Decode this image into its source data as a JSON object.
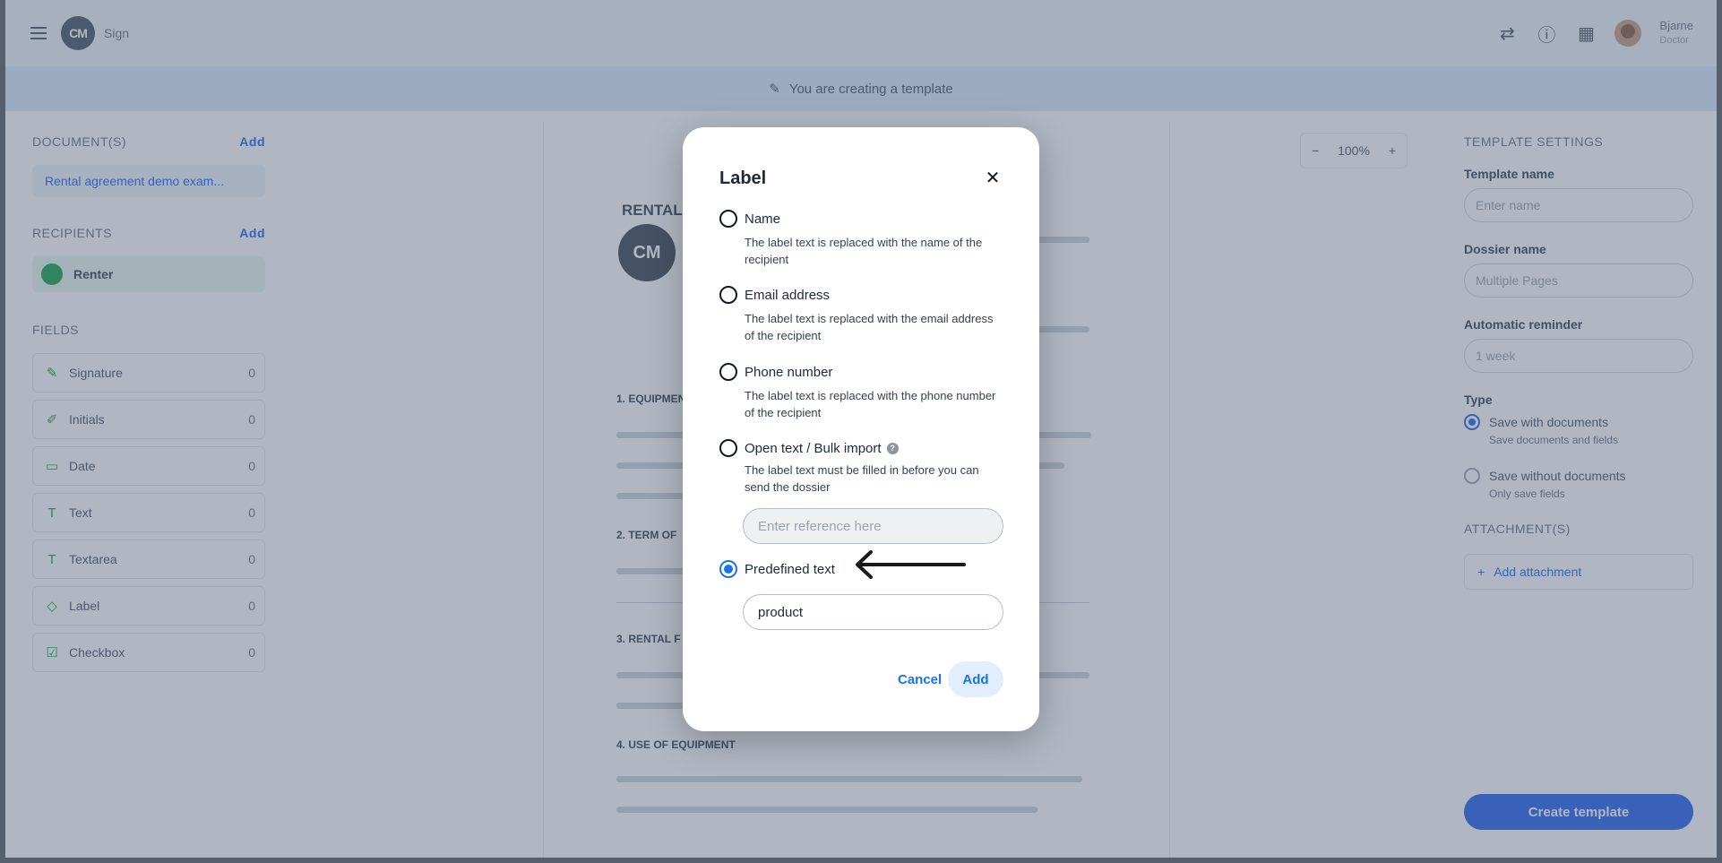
{
  "topbar": {
    "logo_text": "CM",
    "app_name": "Sign",
    "user_name": "Bjarne",
    "user_sub": "Doctor"
  },
  "banner": {
    "text": "You are creating a template"
  },
  "left": {
    "documents_heading": "DOCUMENT(S)",
    "add_label": "Add",
    "document_name": "Rental agreement demo exam...",
    "recipients_heading": "RECIPIENTS",
    "recipient_name": "Renter",
    "fields_heading": "FIELDS",
    "fields": [
      {
        "label": "Signature",
        "count": "0"
      },
      {
        "label": "Initials",
        "count": "0"
      },
      {
        "label": "Date",
        "count": "0"
      },
      {
        "label": "Text",
        "count": "0"
      },
      {
        "label": "Textarea",
        "count": "0"
      },
      {
        "label": "Label",
        "count": "0"
      },
      {
        "label": "Checkbox",
        "count": "0"
      }
    ]
  },
  "document": {
    "zoom": "100%",
    "title": "RENTAL",
    "logo_text": "CM",
    "h1": "1. EQUIPMENT",
    "h2": "2. TERM OF",
    "h3": "3. RENTAL F",
    "h4": "4. USE OF EQUIPMENT"
  },
  "right": {
    "heading": "TEMPLATE SETTINGS",
    "template_name_label": "Template name",
    "template_name_placeholder": "Enter name",
    "dossier_name_label": "Dossier name",
    "dossier_name_value": "Multiple Pages",
    "reminder_label": "Automatic reminder",
    "reminder_value": "1 week",
    "type_label": "Type",
    "type_option1": "Save with documents",
    "type_option1_sub": "Save documents and fields",
    "type_option2": "Save without documents",
    "type_option2_sub": "Only save fields",
    "attachments_heading": "ATTACHMENT(S)",
    "add_attachment": "Add attachment",
    "create_button": "Create template"
  },
  "modal": {
    "title": "Label",
    "options": [
      {
        "label": "Name",
        "desc": "The label text is replaced with the name of the recipient"
      },
      {
        "label": "Email address",
        "desc": "The label text is replaced with the email address of the recipient"
      },
      {
        "label": "Phone number",
        "desc": "The label text is replaced with the phone number of the recipient"
      },
      {
        "label": "Open text / Bulk import",
        "desc": "The label text must be filled in before you can send the dossier"
      },
      {
        "label": "Predefined text"
      }
    ],
    "selected_option": "Predefined text",
    "reference_placeholder": "Enter reference here",
    "predefined_value": "product",
    "cancel_label": "Cancel",
    "add_label": "Add"
  }
}
